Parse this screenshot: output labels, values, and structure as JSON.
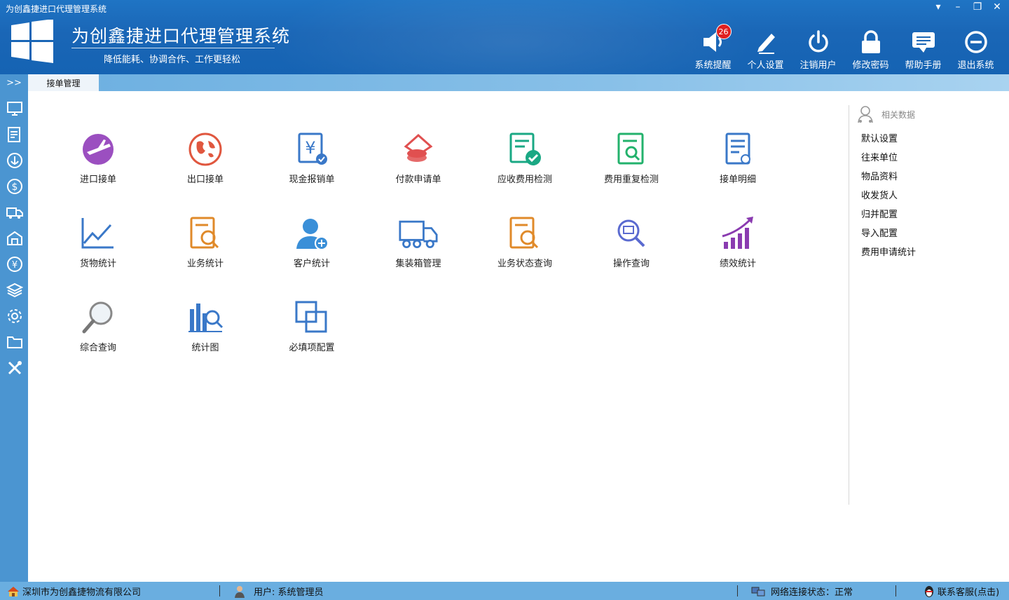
{
  "window": {
    "title": "为创鑫捷进口代理管理系统",
    "controls": [
      "▾",
      "–",
      "❐",
      "✕"
    ]
  },
  "header": {
    "app_title": "为创鑫捷进口代理管理系统",
    "subtitle": "降低能耗、协调合作、工作更轻松",
    "buttons": [
      {
        "label": "系统提醒",
        "icon": "speaker-icon",
        "badge": "26"
      },
      {
        "label": "个人设置",
        "icon": "pencil-icon"
      },
      {
        "label": "注销用户",
        "icon": "power-icon"
      },
      {
        "label": "修改密码",
        "icon": "lock-icon"
      },
      {
        "label": "帮助手册",
        "icon": "chat-icon"
      },
      {
        "label": "退出系统",
        "icon": "minus-circle-icon"
      }
    ]
  },
  "tabbar": {
    "expand": ">>",
    "active_tab": "接单管理"
  },
  "sidebar": [
    "monitor-icon",
    "form-icon",
    "anchor-icon",
    "dollar-icon",
    "truck-icon",
    "warehouse-icon",
    "yen-icon",
    "layers-icon",
    "gear-icon",
    "folder-icon",
    "tools-icon"
  ],
  "tiles": [
    {
      "label": "进口接单",
      "icon": "plane-globe-icon",
      "color": "#9b4fc0"
    },
    {
      "label": "出口接单",
      "icon": "globe-icon",
      "color": "#e0573f"
    },
    {
      "label": "现金报销单",
      "icon": "yen-doc-icon",
      "color": "#3a78c8"
    },
    {
      "label": "付款申请单",
      "icon": "coins-icon",
      "color": "#e05050"
    },
    {
      "label": "应收费用检测",
      "icon": "doc-check-icon",
      "color": "#1aa884"
    },
    {
      "label": "费用重复检测",
      "icon": "doc-search-icon",
      "color": "#23b26c"
    },
    {
      "label": "接单明细",
      "icon": "doc-list-icon",
      "color": "#3a78c8"
    },
    {
      "label": "货物统计",
      "icon": "line-chart-icon",
      "color": "#3a78c8"
    },
    {
      "label": "业务统计",
      "icon": "doc-magnify-icon",
      "color": "#e08a2a"
    },
    {
      "label": "客户统计",
      "icon": "user-add-icon",
      "color": "#3a8fd8"
    },
    {
      "label": "集装箱管理",
      "icon": "truck-icon",
      "color": "#3a78c8"
    },
    {
      "label": "业务状态查询",
      "icon": "doc-magnify-icon",
      "color": "#e08a2a"
    },
    {
      "label": "操作查询",
      "icon": "search-screen-icon",
      "color": "#5a6ad0"
    },
    {
      "label": "绩效统计",
      "icon": "bar-growth-icon",
      "color": "#8a3bb0"
    },
    {
      "label": "综合查询",
      "icon": "magnifier-icon",
      "color": "#888888"
    },
    {
      "label": "统计图",
      "icon": "bar-search-icon",
      "color": "#3a78c8"
    },
    {
      "label": "必填项配置",
      "icon": "squares-icon",
      "color": "#3a78c8"
    }
  ],
  "right_panel": {
    "title": "相关数据",
    "links": [
      "默认设置",
      "往来单位",
      "物品资料",
      "收发货人",
      "归并配置",
      "导入配置",
      "费用申请统计"
    ]
  },
  "status": {
    "company": "深圳市为创鑫捷物流有限公司",
    "user": "用户: 系统管理员",
    "network": "网络连接状态：正常",
    "support": "联系客服(点击)"
  }
}
